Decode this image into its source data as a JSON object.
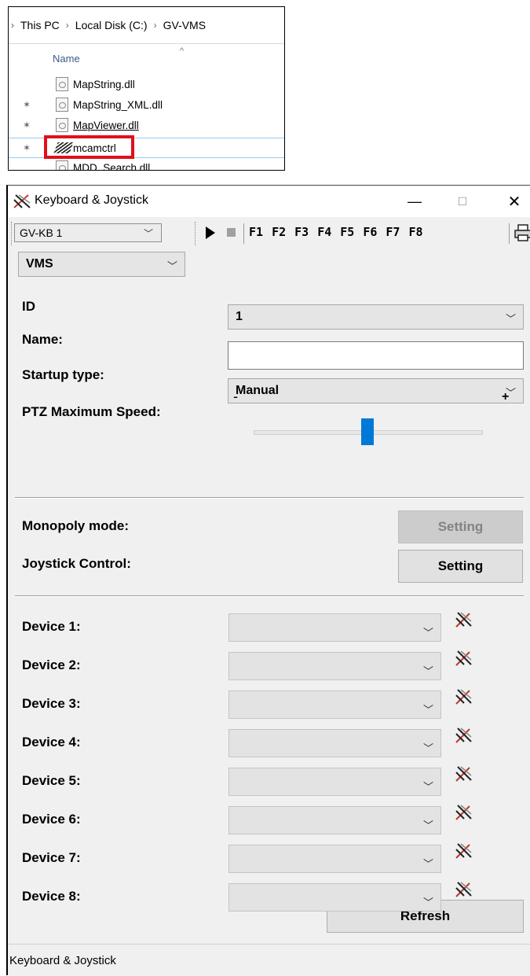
{
  "explorer": {
    "breadcrumbs": [
      "This PC",
      "Local Disk (C:)",
      "GV-VMS"
    ],
    "column_header": "Name",
    "files": [
      {
        "name": "MapString.dll"
      },
      {
        "name": "MapString_XML.dll"
      },
      {
        "name": "MapViewer.dll"
      },
      {
        "name": "mcamctrl"
      },
      {
        "name": "MDD_Search.dll"
      }
    ],
    "highlight_color": "#e0101a"
  },
  "window": {
    "title": "Keyboard & Joystick",
    "controls": {
      "minimize": "—",
      "maximize": "☐",
      "close": "✕"
    },
    "toolbar": {
      "keyboard_select": "GV-KB 1",
      "fkeys": [
        "F1",
        "F2",
        "F3",
        "F4",
        "F5",
        "F6",
        "F7",
        "F8"
      ]
    },
    "mode_select": "VMS",
    "fields": {
      "id_label": "ID",
      "id_value": "1",
      "name_label": "Name:",
      "name_value": "",
      "startup_label": "Startup type:",
      "startup_value": "Manual",
      "ptz_label": "PTZ Maximum Speed:",
      "ptz_minus": "-",
      "ptz_plus": "+",
      "ptz_speed_fraction": 0.5
    },
    "monopoly": {
      "label": "Monopoly mode:",
      "button": "Setting"
    },
    "joystick": {
      "label": "Joystick Control:",
      "button": "Setting"
    },
    "devices": [
      {
        "label": "Device 1:",
        "value": ""
      },
      {
        "label": "Device 2:",
        "value": ""
      },
      {
        "label": "Device 3:",
        "value": ""
      },
      {
        "label": "Device 4:",
        "value": ""
      },
      {
        "label": "Device 5:",
        "value": ""
      },
      {
        "label": "Device 6:",
        "value": ""
      },
      {
        "label": "Device 7:",
        "value": ""
      },
      {
        "label": "Device 8:",
        "value": ""
      }
    ],
    "refresh_button": "Refresh",
    "status_text": "Keyboard & Joystick",
    "accent": "#0078d7"
  }
}
